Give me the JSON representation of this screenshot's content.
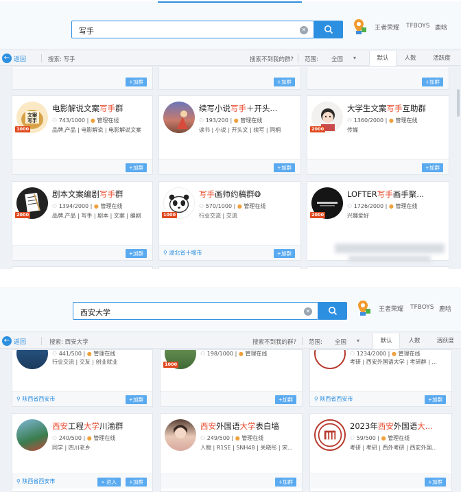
{
  "screens": [
    {
      "search": {
        "value": "写手"
      },
      "hotwords": [
        "王者荣耀",
        "TFBOYS",
        "鹿晗"
      ],
      "toolbar": {
        "back": "返回",
        "search_label": "搜索: 写手",
        "cant_find": "搜索不到我的群?",
        "range_label": "范围:",
        "range_value": "全国",
        "tabs": [
          "默认",
          "人数",
          "活跃度"
        ]
      },
      "groups": [
        {
          "title_pre": "电影解说文案",
          "title_hl": "写手",
          "title_post": "群",
          "members": "743/1000",
          "admin": "管理在线",
          "tags": "品牌,产品 | 电影解说 | 电影解说文案",
          "badge": "1000",
          "join": "+加群"
        },
        {
          "title_pre": "续写小说",
          "title_hl": "写手",
          "title_post": "＋开头...",
          "members": "193/200",
          "admin": "管理在线",
          "tags": "读书 | 小说 | 开头文 | 续写 | 同桐",
          "badge": "",
          "join": "+加群"
        },
        {
          "title_pre": "大学生文案",
          "title_hl": "写手",
          "title_post": "互助群",
          "members": "1360/2000",
          "admin": "管理在线",
          "tags": "传媒",
          "badge": "2000",
          "join": "+加群"
        },
        {
          "title_pre": "剧本文案编剧",
          "title_hl": "写手",
          "title_post": "群",
          "members": "1394/2000",
          "admin": "管理在线",
          "tags": "品牌,产品 | 写手 | 剧本 | 文案 | 编剧",
          "badge": "2000",
          "join": "+加群"
        },
        {
          "title_pre": "",
          "title_hl": "写手",
          "title_post": "画师约稿群❂",
          "members": "570/1000",
          "admin": "管理在线",
          "tags": "行业交流 | 交流",
          "badge": "1000",
          "location": "湖北省十堰市",
          "join": "+加群"
        },
        {
          "title_pre": "LOFTER",
          "title_hl": "写手",
          "title_post": "画手聚...",
          "members": "1726/2000",
          "admin": "管理在线",
          "tags": "兴趣爱好",
          "badge": "2000",
          "join": ""
        }
      ],
      "top_joins": [
        "+加群",
        "+加群",
        "+加群"
      ]
    },
    {
      "search": {
        "value": "西安大学"
      },
      "hotwords": [
        "王者荣耀",
        "TFBOYS",
        "鹿晗"
      ],
      "toolbar": {
        "back": "返回",
        "search_label": "搜索: 西安大学",
        "cant_find": "搜索不到我的群?",
        "range_label": "范围:",
        "range_value": "全国",
        "tabs": [
          "默认",
          "人数",
          "活跃度"
        ]
      },
      "partial_groups": [
        {
          "members": "441/500",
          "admin": "管理在线",
          "tags": "行业交流 | 交友 | 创业就业",
          "location": "陕西省西安市",
          "join": "+加群"
        },
        {
          "members": "198/1000",
          "admin": "管理在线",
          "badge": "1000",
          "join": "+加群"
        },
        {
          "members": "1234/2000",
          "admin": "管理在线",
          "tags": "考研 | 西安外国语大学 | 考研群 | ...",
          "location": "陕西省西安市",
          "join": "+加群"
        }
      ],
      "groups": [
        {
          "t1": "西安",
          "t2": "工程",
          "t3": "大学",
          "t4": "川渝群",
          "members": "240/500",
          "admin": "管理在线",
          "tags": "同学 | 四川老乡",
          "location": "陕西省西安市",
          "enter": "» 进入",
          "join": "+加群"
        },
        {
          "t1": "西安",
          "t2": "外国语",
          "t3": "大学",
          "t4": "表白墙",
          "members": "249/500",
          "admin": "管理在线",
          "tags": "人物 | R1SE | SNH48 | 关晓彤 | 宋...",
          "join": "+加群"
        },
        {
          "t0": "2023年",
          "t1": "西安",
          "t2": "外国语",
          "t3": "大...",
          "t4": "",
          "members": "59/500",
          "admin": "管理在线",
          "tags": "考研 | 考研 | 西外考研 | 西安外国...",
          "join": "+加群"
        }
      ]
    }
  ]
}
